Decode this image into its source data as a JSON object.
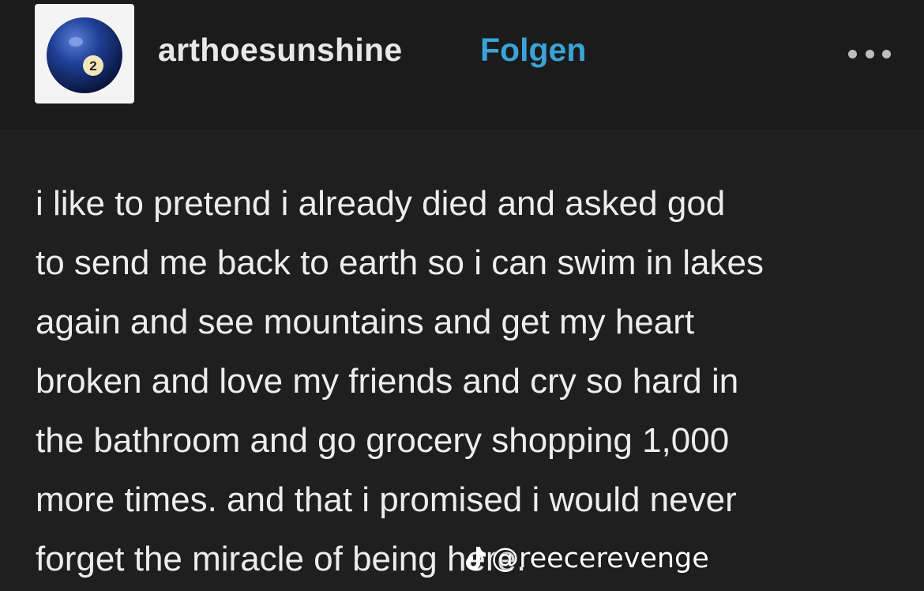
{
  "header": {
    "avatar_badge_number": "2",
    "username": "arthoesunshine",
    "follow_label": "Folgen",
    "more_icon": "more-horizontal-icon"
  },
  "post": {
    "text": "i like to pretend i already died and asked god\nto send me back to earth so i can swim in lakes\nagain and see mountains and get my heart\nbroken and love my friends and cry so hard in\nthe bathroom and go grocery shopping 1,000\nmore times. and that i promised i would never\nforget the miracle of being here."
  },
  "watermark": {
    "icon": "tiktok-icon",
    "handle": "@reecerevenge"
  },
  "colors": {
    "background": "#1f1f1f",
    "follow_accent": "#3aa3d8",
    "text": "#ededed"
  }
}
